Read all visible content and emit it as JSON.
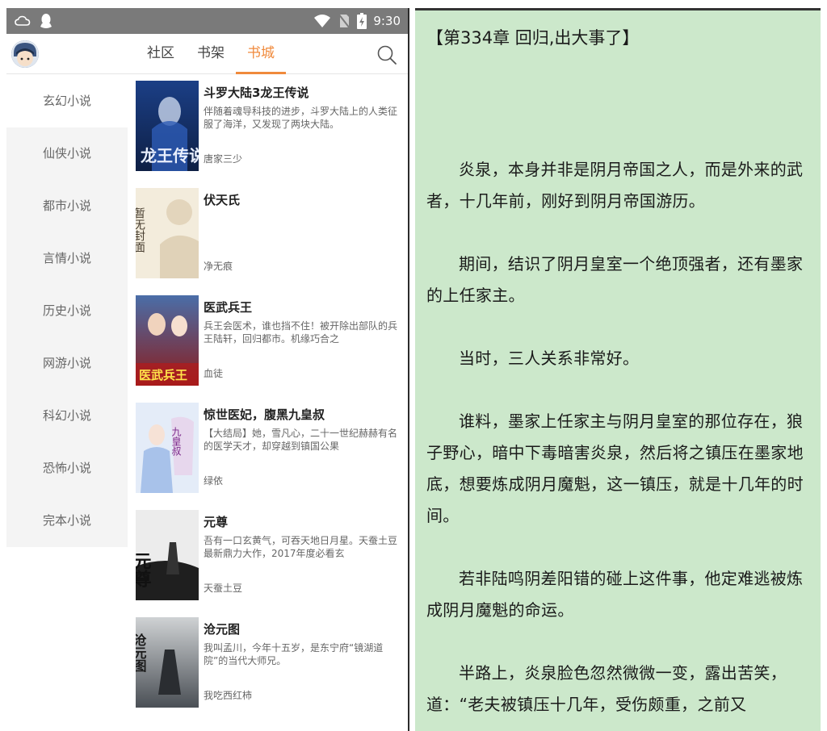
{
  "status_bar": {
    "time": "9:30",
    "left_icons": [
      "weather-icon",
      "qq-icon"
    ],
    "right_icons": [
      "wifi-icon",
      "no-sim-icon",
      "battery-icon"
    ]
  },
  "nav": {
    "tabs": [
      {
        "label": "社区",
        "active": false
      },
      {
        "label": "书架",
        "active": false
      },
      {
        "label": "书城",
        "active": true
      }
    ],
    "accent_color": "#f08a3c"
  },
  "categories": [
    {
      "label": "玄幻小说",
      "active": true
    },
    {
      "label": "仙侠小说",
      "active": false
    },
    {
      "label": "都市小说",
      "active": false
    },
    {
      "label": "言情小说",
      "active": false
    },
    {
      "label": "历史小说",
      "active": false
    },
    {
      "label": "网游小说",
      "active": false
    },
    {
      "label": "科幻小说",
      "active": false
    },
    {
      "label": "恐怖小说",
      "active": false
    },
    {
      "label": "完本小说",
      "active": false
    }
  ],
  "books": [
    {
      "title": "斗罗大陆3龙王传说",
      "desc": "伴随着魂导科技的进步，斗罗大陆上的人类征服了海洋，又发现了两块大陆。",
      "author": "唐家三少",
      "cover_text": "龙王传说"
    },
    {
      "title": "伏天氏",
      "desc": "",
      "author": "净无痕",
      "cover_text": "暂无封面"
    },
    {
      "title": "医武兵王",
      "desc": "兵王会医术，谁也挡不住！被开除出部队的兵王陆轩，回归都市。机缘巧合之",
      "author": "血徒",
      "cover_text": "医武兵王"
    },
    {
      "title": "惊世医妃，腹黑九皇叔",
      "desc": "【大结局】她，雪凡心，二十一世纪赫赫有名的医学天才，却穿越到镇国公果",
      "author": "绿依",
      "cover_text": "九皇叔"
    },
    {
      "title": "元尊",
      "desc": "吾有一口玄黄气，可吞天地日月星。天蚕土豆最新鼎力大作，2017年度必看玄",
      "author": "天蚕土豆",
      "cover_text": "元尊"
    },
    {
      "title": "沧元图",
      "desc": "我叫孟川，今年十五岁，是东宁府“镜湖道院”的当代大师兄。",
      "author": "我吃西红柿",
      "cover_text": "沧元图"
    }
  ],
  "reader": {
    "background": "#cce8cb",
    "chapter_title": "【第334章 回归,出大事了】",
    "paragraphs": [
      "炎泉，本身并非是阴月帝国之人，而是外来的武者，十几年前，刚好到阴月帝国游历。",
      "期间，结识了阴月皇室一个绝顶强者，还有墨家的上任家主。",
      "当时，三人关系非常好。",
      "谁料，墨家上任家主与阴月皇室的那位存在，狼子野心，暗中下毒暗害炎泉，然后将之镇压在墨家地底，想要炼成阴月魔魁，这一镇压，就是十几年的时间。",
      "若非陆鸣阴差阳错的碰上这件事，他定难逃被炼成阴月魔魁的命运。",
      "半路上，炎泉脸色忽然微微一变，露出苦笑，道：“老夫被镇压十几年，受伤颇重，之前又"
    ]
  }
}
